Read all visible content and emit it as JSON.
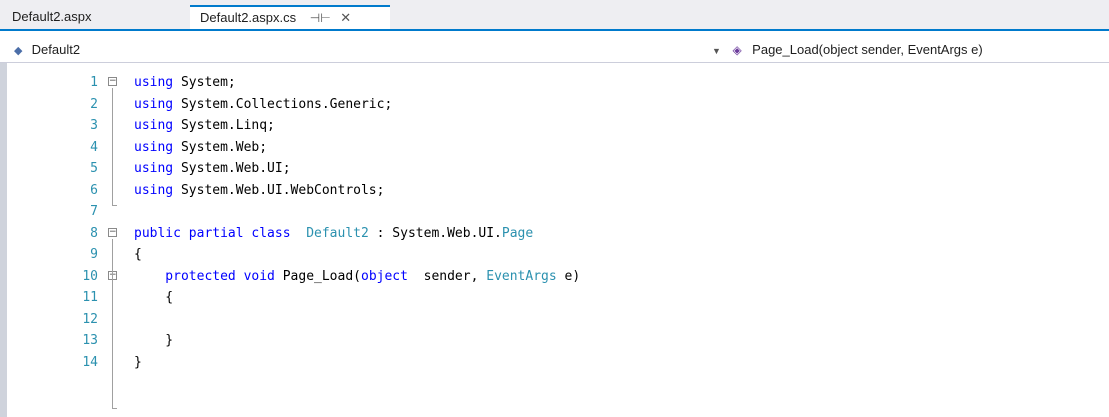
{
  "tabs": [
    {
      "label": "Default2.aspx"
    },
    {
      "label": "Default2.aspx.cs",
      "pin": "⊣⊢",
      "close": "✕"
    }
  ],
  "nav": {
    "left_class": "Default2",
    "right_method": "Page_Load(object sender, EventArgs e)"
  },
  "lines": [
    {
      "n": "1",
      "tokens": [
        [
          "kw",
          "using"
        ],
        [
          "",
          "System;"
        ]
      ]
    },
    {
      "n": "2",
      "tokens": [
        [
          "kw",
          "using"
        ],
        [
          "",
          "System.Collections.Generic;"
        ]
      ]
    },
    {
      "n": "3",
      "tokens": [
        [
          "kw",
          "using"
        ],
        [
          "",
          "System.Linq;"
        ]
      ]
    },
    {
      "n": "4",
      "tokens": [
        [
          "kw",
          "using"
        ],
        [
          "",
          "System.Web;"
        ]
      ]
    },
    {
      "n": "5",
      "tokens": [
        [
          "kw",
          "using"
        ],
        [
          "",
          "System.Web.UI;"
        ]
      ]
    },
    {
      "n": "6",
      "tokens": [
        [
          "kw",
          "using"
        ],
        [
          "",
          "System.Web.UI.WebControls;"
        ]
      ]
    },
    {
      "n": "7",
      "tokens": []
    },
    {
      "n": "8",
      "tokens": [
        [
          "kw",
          "public partial class"
        ],
        [
          "ty",
          "Default2"
        ],
        [
          "",
          " : System.Web.UI."
        ],
        [
          "ty",
          "Page"
        ]
      ]
    },
    {
      "n": "9",
      "tokens": [
        [
          "",
          "{"
        ]
      ]
    },
    {
      "n": "10",
      "tokens": [
        [
          "kw",
          "    protected void"
        ],
        [
          "",
          "Page_Load("
        ],
        [
          "kw",
          "object"
        ],
        [
          "",
          " sender, "
        ],
        [
          "ty",
          "EventArgs"
        ],
        [
          "",
          " e)"
        ]
      ]
    },
    {
      "n": "11",
      "tokens": [
        [
          "",
          "    {"
        ]
      ]
    },
    {
      "n": "12",
      "tokens": []
    },
    {
      "n": "13",
      "tokens": [
        [
          "",
          "    }"
        ]
      ]
    },
    {
      "n": "14",
      "tokens": [
        [
          "",
          "}"
        ]
      ]
    }
  ],
  "colors": {
    "keyword": "#0000ff",
    "type": "#2b91af",
    "line_number": "#2b91af",
    "accent": "#007acc"
  },
  "icons": {
    "class_nav": "class-icon",
    "method_nav": "method-icon",
    "fold": "collapse-icon"
  }
}
